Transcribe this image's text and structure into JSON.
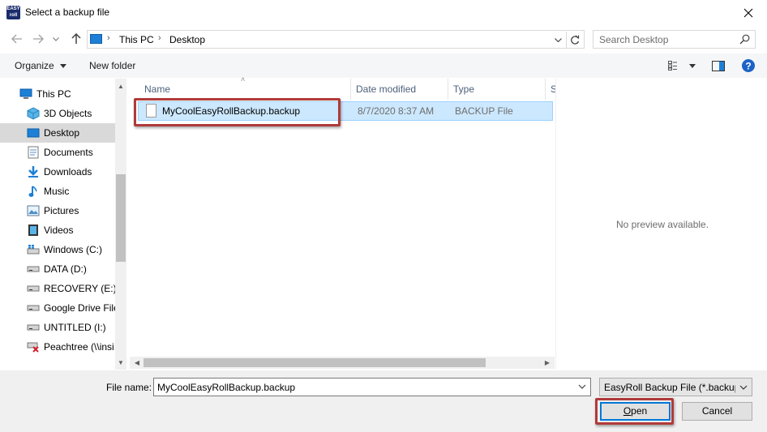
{
  "window": {
    "title": "Select a backup file",
    "app_icon": "easyroll-app-icon",
    "app_icon_text": "EASY roll",
    "close_icon": "close-icon"
  },
  "navigation": {
    "back_icon": "arrow-left-icon",
    "forward_icon": "arrow-right-icon",
    "recent_icon": "chevron-down-icon",
    "up_icon": "arrow-up-icon",
    "breadcrumb": [
      "This PC",
      "Desktop"
    ],
    "refresh_icon": "refresh-icon",
    "search_placeholder": "Search Desktop",
    "search_icon": "search-icon"
  },
  "toolbar": {
    "organize_label": "Organize",
    "new_folder_label": "New folder",
    "view_icon": "view-options-icon",
    "preview_pane_icon": "preview-pane-icon",
    "help_icon": "help-icon"
  },
  "sidebar": {
    "items": [
      {
        "label": "This PC",
        "icon": "computer-icon",
        "selected": false
      },
      {
        "label": "3D Objects",
        "icon": "3d-objects-icon",
        "selected": false
      },
      {
        "label": "Desktop",
        "icon": "desktop-icon",
        "selected": true
      },
      {
        "label": "Documents",
        "icon": "documents-icon",
        "selected": false
      },
      {
        "label": "Downloads",
        "icon": "downloads-icon",
        "selected": false
      },
      {
        "label": "Music",
        "icon": "music-icon",
        "selected": false
      },
      {
        "label": "Pictures",
        "icon": "pictures-icon",
        "selected": false
      },
      {
        "label": "Videos",
        "icon": "videos-icon",
        "selected": false
      },
      {
        "label": "Windows (C:)",
        "icon": "drive-icon",
        "selected": false
      },
      {
        "label": "DATA (D:)",
        "icon": "drive-icon",
        "selected": false
      },
      {
        "label": "RECOVERY (E:)",
        "icon": "drive-icon",
        "selected": false
      },
      {
        "label": "Google Drive File",
        "icon": "drive-icon",
        "selected": false
      },
      {
        "label": "UNTITLED (I:)",
        "icon": "drive-icon",
        "selected": false
      },
      {
        "label": "Peachtree (\\\\insi",
        "icon": "network-drive-disconnected-icon",
        "selected": false
      }
    ]
  },
  "file_list": {
    "columns": [
      "Name",
      "Date modified",
      "Type",
      "S"
    ],
    "rows": [
      {
        "name": "MyCoolEasyRollBackup.backup",
        "date_modified": "8/7/2020 8:37 AM",
        "type": "BACKUP File",
        "selected": true
      }
    ]
  },
  "preview": {
    "message": "No preview available."
  },
  "footer": {
    "file_name_label": "File name:",
    "file_name_value": "MyCoolEasyRollBackup.backup",
    "file_type_filter": "EasyRoll Backup File  (*.backup)",
    "open_label": "Open",
    "cancel_label": "Cancel"
  },
  "colors": {
    "selection_fill": "#cce8ff",
    "selection_border": "#99d1ff",
    "annotation_highlight": "#b03a3a",
    "primary_button_border": "#0078d7",
    "sidebar_selected": "#d9d9d9"
  }
}
